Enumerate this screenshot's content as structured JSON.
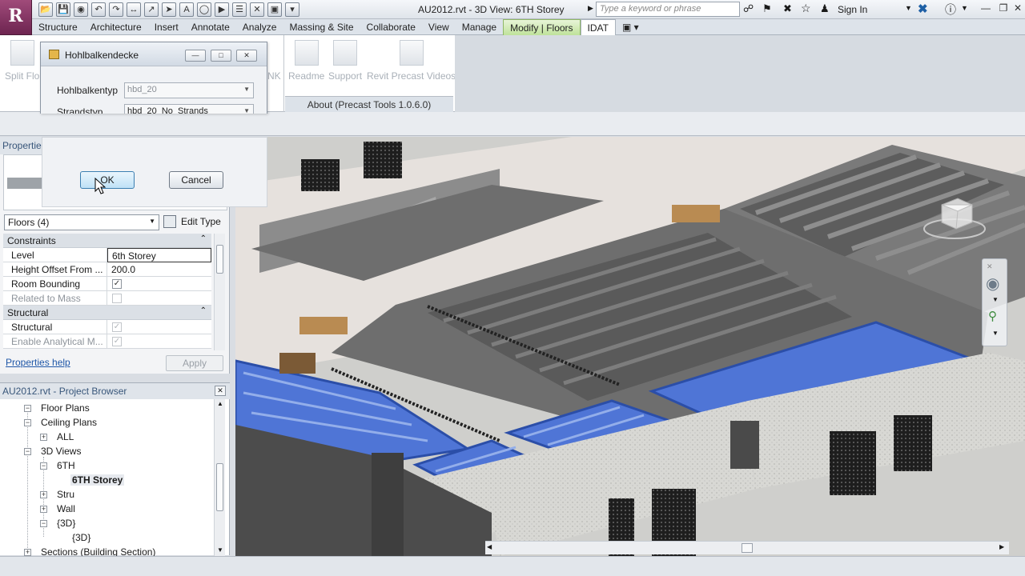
{
  "app": {
    "logo_letter": "R",
    "title": "AU2012.rvt - 3D View: 6TH Storey",
    "search_placeholder": "Type a keyword or phrase",
    "sign_in": "Sign In"
  },
  "ribbon": {
    "tabs": [
      "Structure",
      "Architecture",
      "Insert",
      "Annotate",
      "Analyze",
      "Massing & Site",
      "Collaborate",
      "View",
      "Manage",
      "Modify | Floors",
      "IDAT"
    ],
    "buttons": {
      "split": "Split Flo",
      "nk": "NK",
      "readme": "Readme",
      "support": "Support",
      "videos": "Revit Precast Videos"
    },
    "about": "About (Precast Tools 1.0.6.0)"
  },
  "hbd_dialog": {
    "title": "Hohlbalkendecke",
    "type_label": "Hohlbalkentyp",
    "type_value": "hbd_20",
    "strand_label": "Strandstyp",
    "strand_value": "hbd_20_No_Strands"
  },
  "ok_dialog": {
    "ok": "OK",
    "cancel": "Cancel"
  },
  "properties": {
    "title": "Propertie",
    "type_selector": "Floors (4)",
    "edit_type": "Edit Type",
    "groups": {
      "constraints": "Constraints",
      "structural": "Structural"
    },
    "rows": {
      "level": {
        "key": "Level",
        "value": "6th Storey"
      },
      "height_offset": {
        "key": "Height Offset From ...",
        "value": "200.0"
      },
      "room_bounding": {
        "key": "Room Bounding",
        "checked": true
      },
      "related_mass": {
        "key": "Related to Mass",
        "checked": false
      },
      "structural": {
        "key": "Structural",
        "checked": true
      },
      "enable_analytical": {
        "key": "Enable Analytical M...",
        "checked": true
      }
    },
    "help": "Properties help",
    "apply": "Apply"
  },
  "browser": {
    "title": "AU2012.rvt - Project Browser",
    "nodes": {
      "floor_plans": "Floor Plans",
      "ceiling_plans": "Ceiling Plans",
      "all": "ALL",
      "views_3d": "3D Views",
      "sixth": "6TH",
      "sixth_storey": "6TH Storey",
      "stru": "Stru",
      "wall": "Wall",
      "braces3d": "{3D}",
      "braces3d_leaf": "{3D}",
      "sections": "Sections (Building Section)"
    }
  },
  "colors": {
    "brand": "#7a2a5c",
    "active_tab": "#bfe29a",
    "selection_blue": "#4f75d6"
  }
}
